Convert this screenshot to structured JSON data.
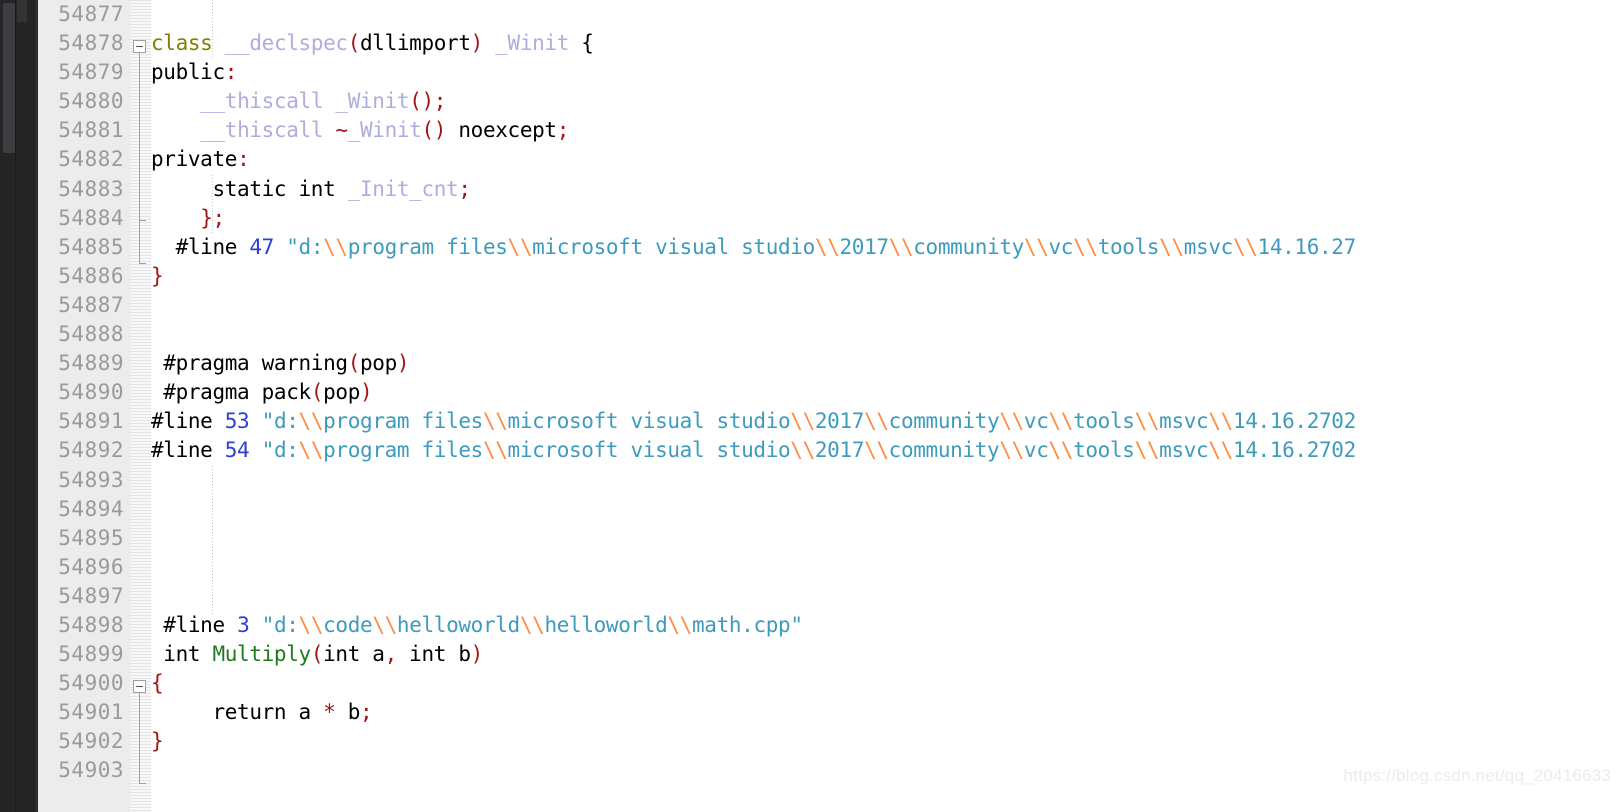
{
  "editor": {
    "app": "Visual Studio C++ Editor",
    "language": "C++",
    "first_line_number": 54877,
    "last_line_number": 54903,
    "colors": {
      "background": "#ffffff",
      "gutter_background": "#ececec",
      "gutter_text": "#9a9a9a",
      "left_panel": "#252526",
      "keyword": "#808000",
      "identifier": "#aeaede",
      "punctuation": "#a31515",
      "string": "#3d9bbd",
      "escape": "#ff8c42",
      "number": "#2b40d4",
      "function": "#1f7a1f",
      "plain_text": "#000000",
      "watermark": "#ececec"
    }
  },
  "watermark": {
    "text": "https://blog.csdn.net/qq_20416633"
  },
  "line_numbers": [
    "54877",
    "54878",
    "54879",
    "54880",
    "54881",
    "54882",
    "54883",
    "54884",
    "54885",
    "54886",
    "54887",
    "54888",
    "54889",
    "54890",
    "54891",
    "54892",
    "54893",
    "54894",
    "54895",
    "54896",
    "54897",
    "54898",
    "54899",
    "54900",
    "54901",
    "54902",
    "54903"
  ],
  "lines": [
    {
      "number": "54877",
      "text": "",
      "tokens": []
    },
    {
      "number": "54878",
      "text": "class __declspec(dllimport) _Winit {",
      "tokens": [
        {
          "t": "class",
          "c": "kw"
        },
        {
          "t": " ",
          "c": "plain"
        },
        {
          "t": "__declspec",
          "c": "ident"
        },
        {
          "t": "(",
          "c": "punct"
        },
        {
          "t": "dllimport",
          "c": "plain"
        },
        {
          "t": ")",
          "c": "punct"
        },
        {
          "t": " ",
          "c": "plain"
        },
        {
          "t": "_Winit",
          "c": "ident"
        },
        {
          "t": " {",
          "c": "plain"
        }
      ]
    },
    {
      "number": "54879",
      "text": "public:",
      "tokens": [
        {
          "t": "public",
          "c": "plain"
        },
        {
          "t": ":",
          "c": "punct"
        }
      ]
    },
    {
      "number": "54880",
      "text": "    __thiscall _Winit();",
      "tokens": [
        {
          "t": "    ",
          "c": "plain"
        },
        {
          "t": "__thiscall",
          "c": "ident"
        },
        {
          "t": " ",
          "c": "plain"
        },
        {
          "t": "_Winit",
          "c": "ident"
        },
        {
          "t": "()",
          "c": "punct"
        },
        {
          "t": ";",
          "c": "punct"
        }
      ]
    },
    {
      "number": "54881",
      "text": "    __thiscall ~_Winit() noexcept;",
      "tokens": [
        {
          "t": "    ",
          "c": "plain"
        },
        {
          "t": "__thiscall",
          "c": "ident"
        },
        {
          "t": " ",
          "c": "plain"
        },
        {
          "t": "~",
          "c": "punct"
        },
        {
          "t": "_Winit",
          "c": "ident"
        },
        {
          "t": "()",
          "c": "punct"
        },
        {
          "t": " noexcept",
          "c": "plain"
        },
        {
          "t": ";",
          "c": "punct"
        }
      ]
    },
    {
      "number": "54882",
      "text": "private:",
      "tokens": [
        {
          "t": "private",
          "c": "plain"
        },
        {
          "t": ":",
          "c": "punct"
        }
      ]
    },
    {
      "number": "54883",
      "text": "     static int _Init_cnt;",
      "tokens": [
        {
          "t": "     static int ",
          "c": "plain"
        },
        {
          "t": "_Init_cnt",
          "c": "ident"
        },
        {
          "t": ";",
          "c": "punct"
        }
      ]
    },
    {
      "number": "54884",
      "text": "    };",
      "tokens": [
        {
          "t": "    ",
          "c": "plain"
        },
        {
          "t": "};",
          "c": "punct"
        }
      ]
    },
    {
      "number": "54885",
      "text": "  #line 47 \"d:\\\\program files\\\\microsoft visual studio\\\\2017\\\\community\\\\vc\\\\tools\\\\msvc\\\\14.16.27",
      "tokens": [
        {
          "t": "  #line ",
          "c": "plain"
        },
        {
          "t": "47",
          "c": "num"
        },
        {
          "t": " ",
          "c": "plain"
        },
        {
          "t": "\"d:",
          "c": "str"
        },
        {
          "t": "\\\\",
          "c": "esc"
        },
        {
          "t": "program files",
          "c": "str"
        },
        {
          "t": "\\\\",
          "c": "esc"
        },
        {
          "t": "microsoft visual studio",
          "c": "str"
        },
        {
          "t": "\\\\",
          "c": "esc"
        },
        {
          "t": "2017",
          "c": "str"
        },
        {
          "t": "\\\\",
          "c": "esc"
        },
        {
          "t": "community",
          "c": "str"
        },
        {
          "t": "\\\\",
          "c": "esc"
        },
        {
          "t": "vc",
          "c": "str"
        },
        {
          "t": "\\\\",
          "c": "esc"
        },
        {
          "t": "tools",
          "c": "str"
        },
        {
          "t": "\\\\",
          "c": "esc"
        },
        {
          "t": "msvc",
          "c": "str"
        },
        {
          "t": "\\\\",
          "c": "esc"
        },
        {
          "t": "14.16.27",
          "c": "str"
        }
      ]
    },
    {
      "number": "54886",
      "text": "}",
      "tokens": [
        {
          "t": "}",
          "c": "punct"
        }
      ]
    },
    {
      "number": "54887",
      "text": "",
      "tokens": []
    },
    {
      "number": "54888",
      "text": "",
      "tokens": []
    },
    {
      "number": "54889",
      "text": " #pragma warning(pop)",
      "tokens": [
        {
          "t": " #pragma warning",
          "c": "plain"
        },
        {
          "t": "(",
          "c": "punct"
        },
        {
          "t": "pop",
          "c": "plain"
        },
        {
          "t": ")",
          "c": "punct"
        }
      ]
    },
    {
      "number": "54890",
      "text": " #pragma pack(pop)",
      "tokens": [
        {
          "t": " #pragma pack",
          "c": "plain"
        },
        {
          "t": "(",
          "c": "punct"
        },
        {
          "t": "pop",
          "c": "plain"
        },
        {
          "t": ")",
          "c": "punct"
        }
      ]
    },
    {
      "number": "54891",
      "text": "#line 53 \"d:\\\\program files\\\\microsoft visual studio\\\\2017\\\\community\\\\vc\\\\tools\\\\msvc\\\\14.16.2702",
      "tokens": [
        {
          "t": "#line ",
          "c": "plain"
        },
        {
          "t": "53",
          "c": "num"
        },
        {
          "t": " ",
          "c": "plain"
        },
        {
          "t": "\"d:",
          "c": "str"
        },
        {
          "t": "\\\\",
          "c": "esc"
        },
        {
          "t": "program files",
          "c": "str"
        },
        {
          "t": "\\\\",
          "c": "esc"
        },
        {
          "t": "microsoft visual studio",
          "c": "str"
        },
        {
          "t": "\\\\",
          "c": "esc"
        },
        {
          "t": "2017",
          "c": "str"
        },
        {
          "t": "\\\\",
          "c": "esc"
        },
        {
          "t": "community",
          "c": "str"
        },
        {
          "t": "\\\\",
          "c": "esc"
        },
        {
          "t": "vc",
          "c": "str"
        },
        {
          "t": "\\\\",
          "c": "esc"
        },
        {
          "t": "tools",
          "c": "str"
        },
        {
          "t": "\\\\",
          "c": "esc"
        },
        {
          "t": "msvc",
          "c": "str"
        },
        {
          "t": "\\\\",
          "c": "esc"
        },
        {
          "t": "14.16.2702",
          "c": "str"
        }
      ]
    },
    {
      "number": "54892",
      "text": "#line 54 \"d:\\\\program files\\\\microsoft visual studio\\\\2017\\\\community\\\\vc\\\\tools\\\\msvc\\\\14.16.2702",
      "tokens": [
        {
          "t": "#line ",
          "c": "plain"
        },
        {
          "t": "54",
          "c": "num"
        },
        {
          "t": " ",
          "c": "plain"
        },
        {
          "t": "\"d:",
          "c": "str"
        },
        {
          "t": "\\\\",
          "c": "esc"
        },
        {
          "t": "program files",
          "c": "str"
        },
        {
          "t": "\\\\",
          "c": "esc"
        },
        {
          "t": "microsoft visual studio",
          "c": "str"
        },
        {
          "t": "\\\\",
          "c": "esc"
        },
        {
          "t": "2017",
          "c": "str"
        },
        {
          "t": "\\\\",
          "c": "esc"
        },
        {
          "t": "community",
          "c": "str"
        },
        {
          "t": "\\\\",
          "c": "esc"
        },
        {
          "t": "vc",
          "c": "str"
        },
        {
          "t": "\\\\",
          "c": "esc"
        },
        {
          "t": "tools",
          "c": "str"
        },
        {
          "t": "\\\\",
          "c": "esc"
        },
        {
          "t": "msvc",
          "c": "str"
        },
        {
          "t": "\\\\",
          "c": "esc"
        },
        {
          "t": "14.16.2702",
          "c": "str"
        }
      ]
    },
    {
      "number": "54893",
      "text": "",
      "tokens": []
    },
    {
      "number": "54894",
      "text": "",
      "tokens": []
    },
    {
      "number": "54895",
      "text": "",
      "tokens": []
    },
    {
      "number": "54896",
      "text": "",
      "tokens": []
    },
    {
      "number": "54897",
      "text": "",
      "tokens": []
    },
    {
      "number": "54898",
      "text": " #line 3 \"d:\\\\code\\\\helloworld\\\\helloworld\\\\math.cpp\"",
      "tokens": [
        {
          "t": " #line ",
          "c": "plain"
        },
        {
          "t": "3",
          "c": "num"
        },
        {
          "t": " ",
          "c": "plain"
        },
        {
          "t": "\"d:",
          "c": "str"
        },
        {
          "t": "\\\\",
          "c": "esc"
        },
        {
          "t": "code",
          "c": "str"
        },
        {
          "t": "\\\\",
          "c": "esc"
        },
        {
          "t": "helloworld",
          "c": "str"
        },
        {
          "t": "\\\\",
          "c": "esc"
        },
        {
          "t": "helloworld",
          "c": "str"
        },
        {
          "t": "\\\\",
          "c": "esc"
        },
        {
          "t": "math.cpp\"",
          "c": "str"
        }
      ]
    },
    {
      "number": "54899",
      "text": " int Multiply(int a, int b)",
      "tokens": [
        {
          "t": " int ",
          "c": "plain"
        },
        {
          "t": "Multiply",
          "c": "fn"
        },
        {
          "t": "(",
          "c": "punct"
        },
        {
          "t": "int a",
          "c": "plain"
        },
        {
          "t": ",",
          "c": "punct"
        },
        {
          "t": " int b",
          "c": "plain"
        },
        {
          "t": ")",
          "c": "punct"
        }
      ]
    },
    {
      "number": "54900",
      "text": "{",
      "tokens": [
        {
          "t": "{",
          "c": "punct"
        }
      ]
    },
    {
      "number": "54901",
      "text": "     return a * b;",
      "tokens": [
        {
          "t": "     return a ",
          "c": "plain"
        },
        {
          "t": "*",
          "c": "op"
        },
        {
          "t": " b",
          "c": "plain"
        },
        {
          "t": ";",
          "c": "punct"
        }
      ]
    },
    {
      "number": "54902",
      "text": "}",
      "tokens": [
        {
          "t": "}",
          "c": "punct"
        }
      ]
    },
    {
      "number": "54903",
      "text": "",
      "tokens": []
    }
  ]
}
